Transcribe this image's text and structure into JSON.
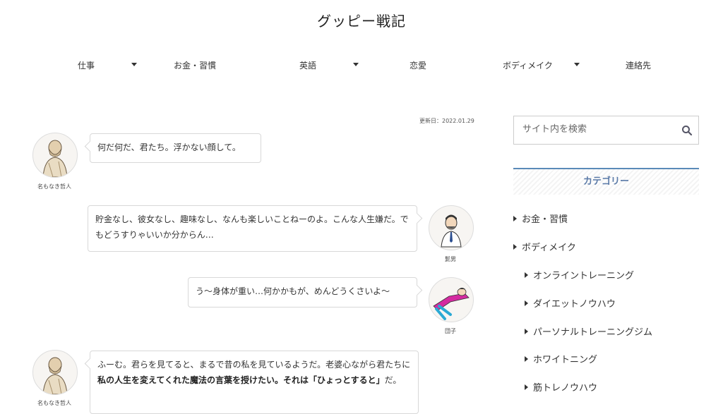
{
  "site": {
    "title": "グッピー戦記"
  },
  "nav": {
    "items": [
      {
        "label": "仕事"
      },
      {
        "label": "お金・習慣"
      },
      {
        "label": "英語"
      },
      {
        "label": "恋愛"
      },
      {
        "label": "ボディメイク"
      },
      {
        "label": "連絡先"
      }
    ]
  },
  "article": {
    "updated": "更新日：2022.01.29",
    "dialogues": [
      {
        "speaker": "名もなき哲人",
        "text": "何だ何だ、君たち。浮かない顔して。"
      },
      {
        "speaker": "髭男",
        "text": "貯金なし、彼女なし、趣味なし、なんも楽しいことねーのよ。こんな人生嫌だ。でもどうすりゃいいか分からん…"
      },
      {
        "speaker": "団子",
        "text": "う〜身体が重い…何かかもが、めんどうくさいよ〜"
      },
      {
        "speaker": "名もなき哲人",
        "text_plain": "ふーむ。君らを見てると、まるで昔の私を見ているようだ。老婆心ながら君たちに",
        "text_bold": "私の人生を変えてくれた魔法の言葉を授けたい。それは「ひょっとすると」",
        "text_tail": "だ。"
      }
    ]
  },
  "sidebar": {
    "search": {
      "placeholder": "サイト内を検索"
    },
    "category_title": "カテゴリー",
    "categories": [
      {
        "label": "お金・習慣"
      },
      {
        "label": "ボディメイク"
      },
      {
        "label": "オンライントレーニング"
      },
      {
        "label": "ダイエットノウハウ"
      },
      {
        "label": "パーソナルトレーニングジム"
      },
      {
        "label": "ホワイトニング"
      },
      {
        "label": "筋トレノウハウ"
      }
    ]
  },
  "colors": {
    "accent": "#5a8ab8",
    "category_text": "#5a7aa8",
    "text": "#333333"
  }
}
